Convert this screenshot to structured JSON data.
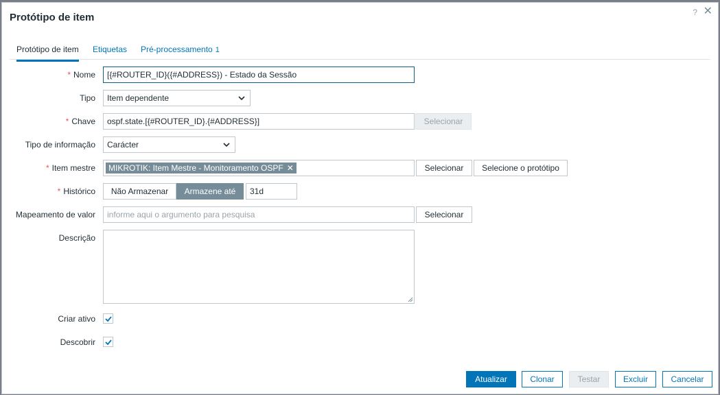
{
  "dialog": {
    "title": "Protótipo de item",
    "help": "?",
    "close": "✕"
  },
  "tabs": [
    {
      "label": "Protótipo de item",
      "active": true
    },
    {
      "label": "Etiquetas",
      "active": false
    },
    {
      "label": "Pré-processamento",
      "count": "1",
      "active": false
    }
  ],
  "form": {
    "nome": {
      "label": "Nome",
      "value": "[{#ROUTER_ID}({#ADDRESS}) - Estado da Sessão"
    },
    "tipo": {
      "label": "Tipo",
      "value": "Item dependente"
    },
    "chave": {
      "label": "Chave",
      "value": "ospf.state.[{#ROUTER_ID}.{#ADDRESS}]",
      "button": "Selecionar"
    },
    "tipo_informacao": {
      "label": "Tipo de informação",
      "value": "Carácter"
    },
    "item_mestre": {
      "label": "Item mestre",
      "chip": "MIKROTIK: Item Mestre - Monitoramento OSPF",
      "chip_remove": "✕",
      "button1": "Selecionar",
      "button2": "Selecione o protótipo"
    },
    "historico": {
      "label": "Histórico",
      "option1": "Não Armazenar",
      "option2": "Armazene até",
      "value": "31d"
    },
    "mapeamento": {
      "label": "Mapeamento de valor",
      "placeholder": "informe aqui o argumento para pesquisa",
      "button": "Selecionar"
    },
    "descricao": {
      "label": "Descrição",
      "value": ""
    },
    "criar_ativo": {
      "label": "Criar ativo",
      "checked": true
    },
    "descobrir": {
      "label": "Descobrir",
      "checked": true
    }
  },
  "footer": {
    "atualizar": "Atualizar",
    "clonar": "Clonar",
    "testar": "Testar",
    "excluir": "Excluir",
    "cancelar": "Cancelar"
  },
  "colors": {
    "accent": "#0275b8",
    "required": "#e45959",
    "chip": "#768d99"
  }
}
